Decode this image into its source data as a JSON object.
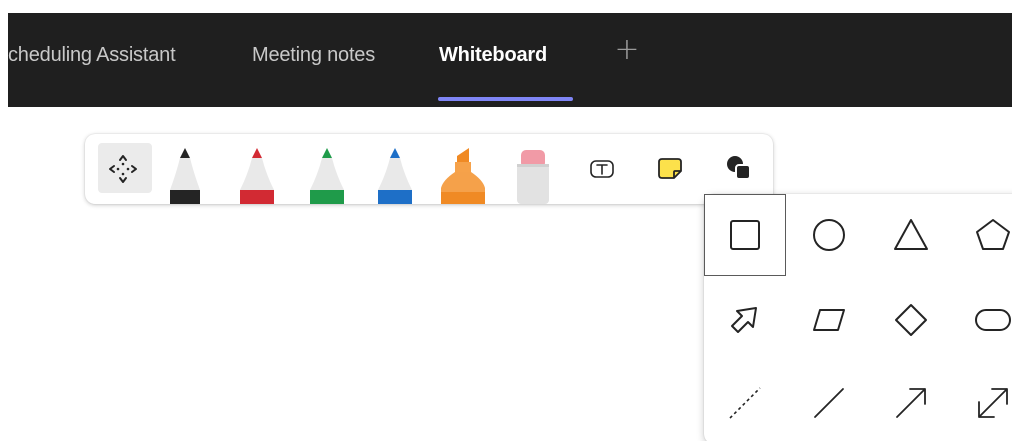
{
  "tabs": [
    {
      "label": "cheduling Assistant",
      "active": false
    },
    {
      "label": "Meeting notes",
      "active": false
    },
    {
      "label": "Whiteboard",
      "active": true
    }
  ],
  "add_tab_glyph": "+",
  "accent_color": "#7f85f5",
  "toolbar": {
    "tools": [
      {
        "name": "move-icon"
      },
      {
        "name": "black-pen-icon",
        "color": "#242424"
      },
      {
        "name": "red-pen-icon",
        "color": "#d22a33"
      },
      {
        "name": "green-pen-icon",
        "color": "#1f9b4a"
      },
      {
        "name": "blue-pen-icon",
        "color": "#1e6fc7"
      },
      {
        "name": "highlighter-icon",
        "color": "#f08a24"
      },
      {
        "name": "eraser-icon",
        "color": "#f19aa6"
      },
      {
        "name": "text-icon",
        "label": "T"
      },
      {
        "name": "sticky-note-icon",
        "color": "#fce14b"
      },
      {
        "name": "shapes-icon"
      }
    ]
  },
  "shapes": [
    [
      "square-icon",
      "circle-icon",
      "triangle-icon",
      "pentagon-icon"
    ],
    [
      "arrow-shape-icon",
      "parallelogram-icon",
      "diamond-icon",
      "ellipse-icon"
    ],
    [
      "dashed-line-icon",
      "line-icon",
      "arrow-line-icon",
      "double-arrow-line-icon"
    ]
  ]
}
